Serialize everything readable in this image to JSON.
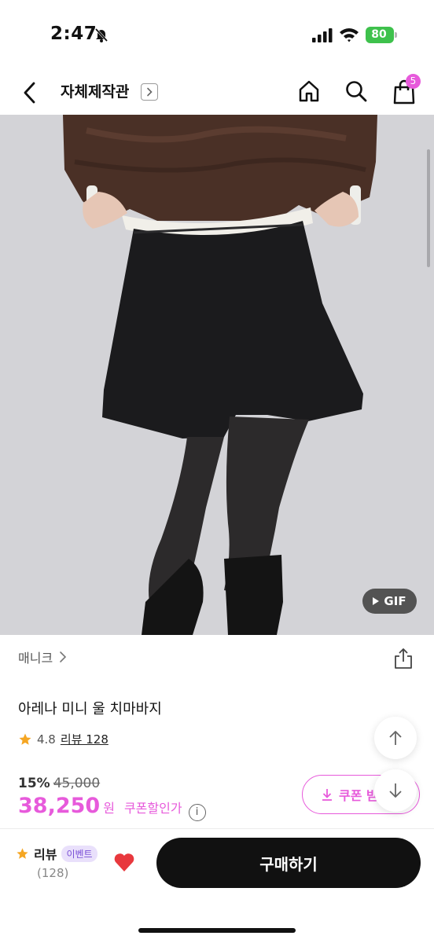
{
  "status_bar": {
    "time": "2:47",
    "battery": "80",
    "battery_color": "#3ec14c",
    "icons": [
      "bell-slash-icon",
      "signal-icon",
      "wifi-icon",
      "battery-icon"
    ]
  },
  "nav": {
    "title": "자체제작관",
    "cart_count": "5",
    "icons": [
      "back-icon",
      "chevron-right-icon",
      "home-icon",
      "search-icon",
      "cart-icon"
    ]
  },
  "hero": {
    "gif_label": "GIF"
  },
  "product": {
    "brand": "매니크",
    "name": "아레나 미니 울 치마바지",
    "rating": "4.8",
    "review_label": "리뷰 128",
    "discount_rate": "15%",
    "original_price": "45,000",
    "sale_price": "38,250",
    "currency": "원",
    "coupon_price_text": "쿠폰할인가",
    "info_glyph": "i",
    "coupon_button_label": "쿠폰 받"
  },
  "bottom_bar": {
    "review_label": "리뷰",
    "event_badge": "이벤트",
    "review_count": "(128)",
    "buy_label": "구매하기",
    "heart_color": "#e8383d"
  },
  "colors": {
    "accent": "#e75adb",
    "star": "#f5a623",
    "buy_button": "#111111"
  }
}
